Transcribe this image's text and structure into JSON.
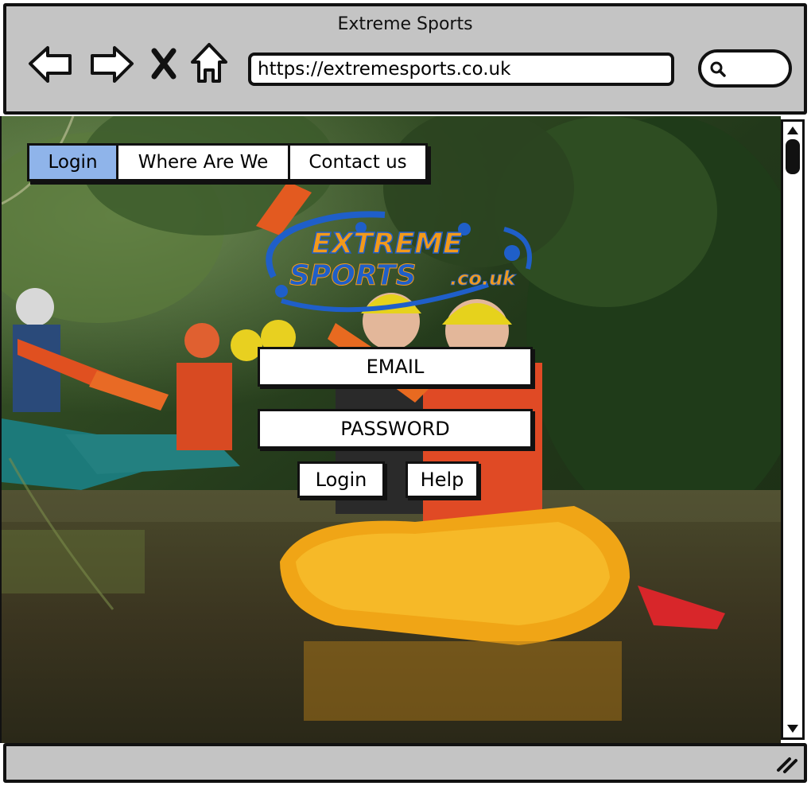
{
  "window": {
    "title": "Extreme Sports"
  },
  "addressbar": {
    "url": "https://extremesports.co.uk"
  },
  "nav": {
    "tabs": [
      {
        "label": "Login",
        "active": true
      },
      {
        "label": "Where Are We",
        "active": false
      },
      {
        "label": "Contact us",
        "active": false
      }
    ]
  },
  "logo": {
    "line1": "EXTREME",
    "line2": "SPORTS",
    "suffix": ".co.uk"
  },
  "form": {
    "email_label": "EMAIL",
    "password_label": "PASSWORD",
    "login_button": "Login",
    "help_button": "Help"
  },
  "colors": {
    "active_tab": "#8fb4ea",
    "chrome": "#c4c4c4",
    "logo_orange": "#f29a1c",
    "logo_blue": "#1f5fc9"
  }
}
